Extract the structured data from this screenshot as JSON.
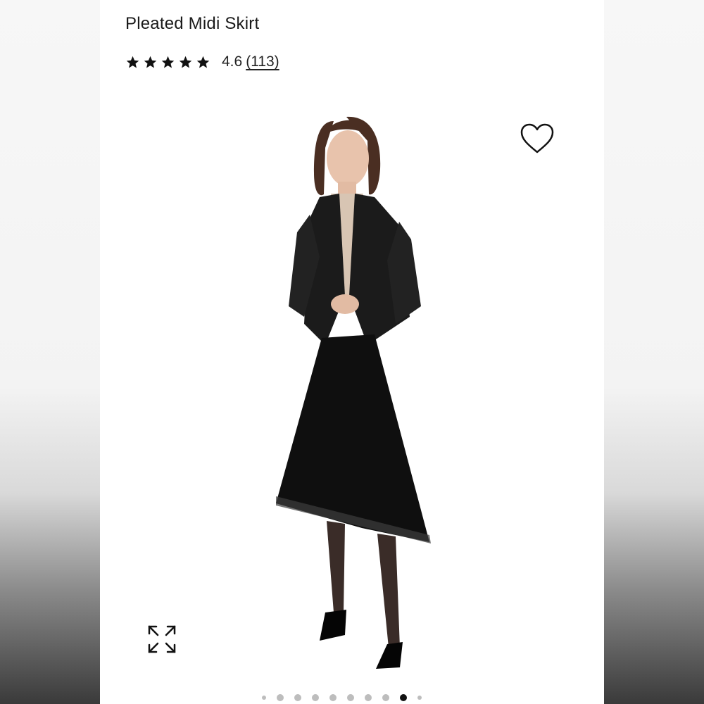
{
  "product": {
    "title": "Pleated Midi Skirt",
    "rating_value": "4.6",
    "rating_count": "(113)",
    "stars": 4.6,
    "max_stars": 5
  },
  "icons": {
    "wishlist": "heart-outline-icon",
    "expand": "expand-arrows-icon",
    "star": "star-icon"
  },
  "carousel": {
    "total_dots": 10,
    "active_index": 8
  },
  "colors": {
    "text": "#1a1a1a",
    "active_dot": "#111111",
    "inactive_dot": "#bdbdbd"
  }
}
